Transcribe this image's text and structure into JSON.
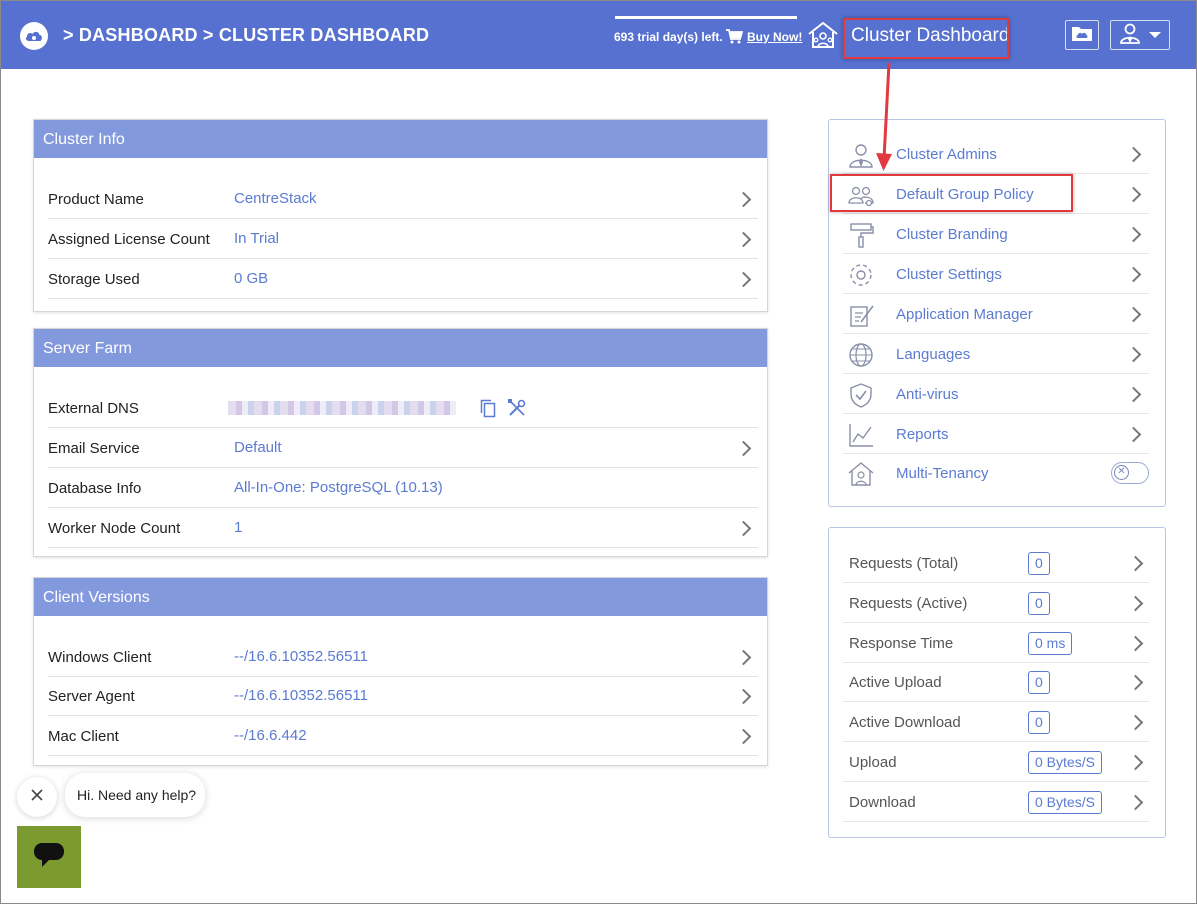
{
  "header": {
    "breadcrumb": "> DASHBOARD > CLUSTER DASHBOARD",
    "trial_text": "693 trial day(s) left.",
    "buy_now": "Buy Now!",
    "title": "Cluster Dashboard",
    "icons": [
      "cloud-logo-icon",
      "cart-icon",
      "home-tenant-icon",
      "cloud-folder-icon",
      "user-icon",
      "caret-down-icon"
    ],
    "colors": {
      "bar": "#5671cf",
      "highlight": "#e0393e"
    }
  },
  "cluster_info": {
    "title": "Cluster Info",
    "rows": [
      {
        "label": "Product Name",
        "value": "CentreStack"
      },
      {
        "label": "Assigned License Count",
        "value": "In Trial"
      },
      {
        "label": "Storage Used",
        "value": "0 GB"
      }
    ]
  },
  "server_farm": {
    "title": "Server Farm",
    "rows": [
      {
        "label": "External DNS",
        "value": ""
      },
      {
        "label": "Email Service",
        "value": "Default"
      },
      {
        "label": "Database Info",
        "value": "All-In-One: PostgreSQL (10.13)"
      },
      {
        "label": "Worker Node Count",
        "value": "1"
      }
    ]
  },
  "client_versions": {
    "title": "Client Versions",
    "rows": [
      {
        "label": "Windows Client",
        "value": "--/16.6.10352.56511"
      },
      {
        "label": "Server Agent",
        "value": "--/16.6.10352.56511"
      },
      {
        "label": "Mac Client",
        "value": "--/16.6.442"
      }
    ]
  },
  "menu": {
    "items": [
      {
        "label": "Cluster Admins",
        "icon": "admin-user-icon"
      },
      {
        "label": "Default Group Policy",
        "icon": "group-policy-icon"
      },
      {
        "label": "Cluster Branding",
        "icon": "paint-roller-icon"
      },
      {
        "label": "Cluster Settings",
        "icon": "gear-icon"
      },
      {
        "label": "Application Manager",
        "icon": "app-manager-icon"
      },
      {
        "label": "Languages",
        "icon": "globe-icon"
      },
      {
        "label": "Anti-virus",
        "icon": "shield-check-icon"
      },
      {
        "label": "Reports",
        "icon": "chart-icon"
      },
      {
        "label": "Multi-Tenancy",
        "icon": "home-tenant-icon"
      }
    ]
  },
  "stats": {
    "rows": [
      {
        "label": "Requests (Total)",
        "value": "0"
      },
      {
        "label": "Requests (Active)",
        "value": "0"
      },
      {
        "label": "Response Time",
        "value": "0 ms"
      },
      {
        "label": "Active Upload",
        "value": "0"
      },
      {
        "label": "Active Download",
        "value": "0"
      },
      {
        "label": "Upload",
        "value": "0 Bytes/S"
      },
      {
        "label": "Download",
        "value": "0 Bytes/S"
      }
    ]
  },
  "chat": {
    "greeting": "Hi. Need any help?",
    "color": "#7b9b31"
  }
}
